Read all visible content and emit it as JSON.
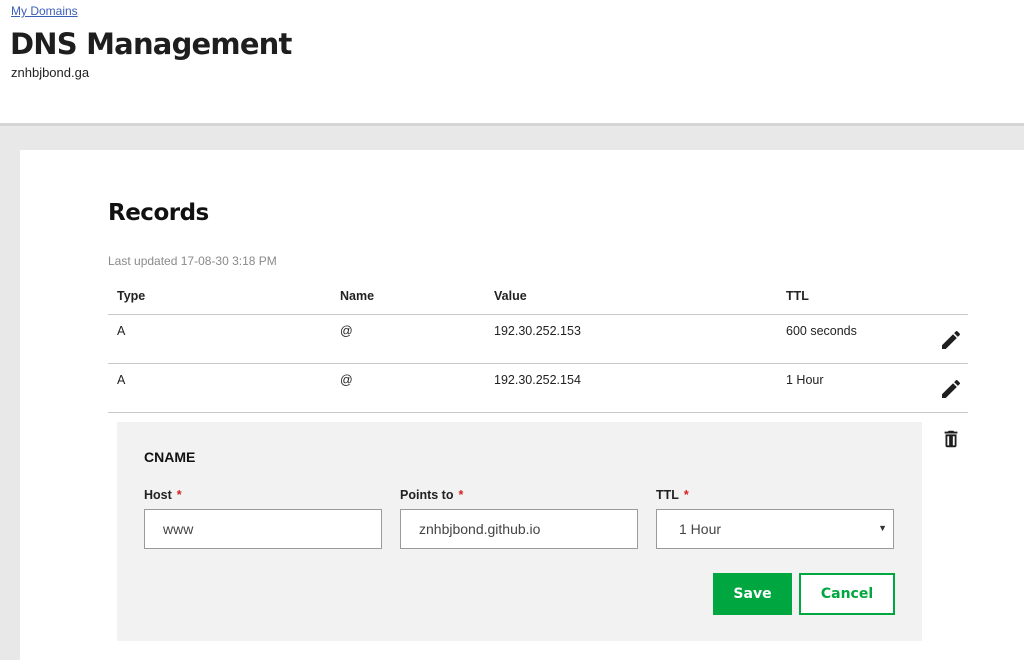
{
  "header": {
    "breadcrumb": "My Domains",
    "title": "DNS Management",
    "domain": "znhbjbond.ga"
  },
  "records": {
    "title": "Records",
    "last_updated": "Last updated 17-08-30 3:18 PM",
    "columns": [
      "Type",
      "Name",
      "Value",
      "TTL"
    ],
    "rows": [
      {
        "type": "A",
        "name": "@",
        "value": "192.30.252.153",
        "ttl": "600 seconds"
      },
      {
        "type": "A",
        "name": "@",
        "value": "192.30.252.154",
        "ttl": "1 Hour"
      }
    ]
  },
  "edit_form": {
    "type": "CNAME",
    "host": {
      "label": "Host",
      "value": "www"
    },
    "points_to": {
      "label": "Points to",
      "value": "znhbjbond.github.io"
    },
    "ttl": {
      "label": "TTL",
      "value": "1 Hour"
    },
    "required_mark": "*",
    "save_label": "Save",
    "cancel_label": "Cancel"
  },
  "icons": {
    "edit": "pencil-icon",
    "delete": "trash-icon",
    "dropdown": "caret-down-icon"
  },
  "colors": {
    "accent": "#00a63f",
    "required": "#d42020",
    "link": "#3b5fb8"
  }
}
